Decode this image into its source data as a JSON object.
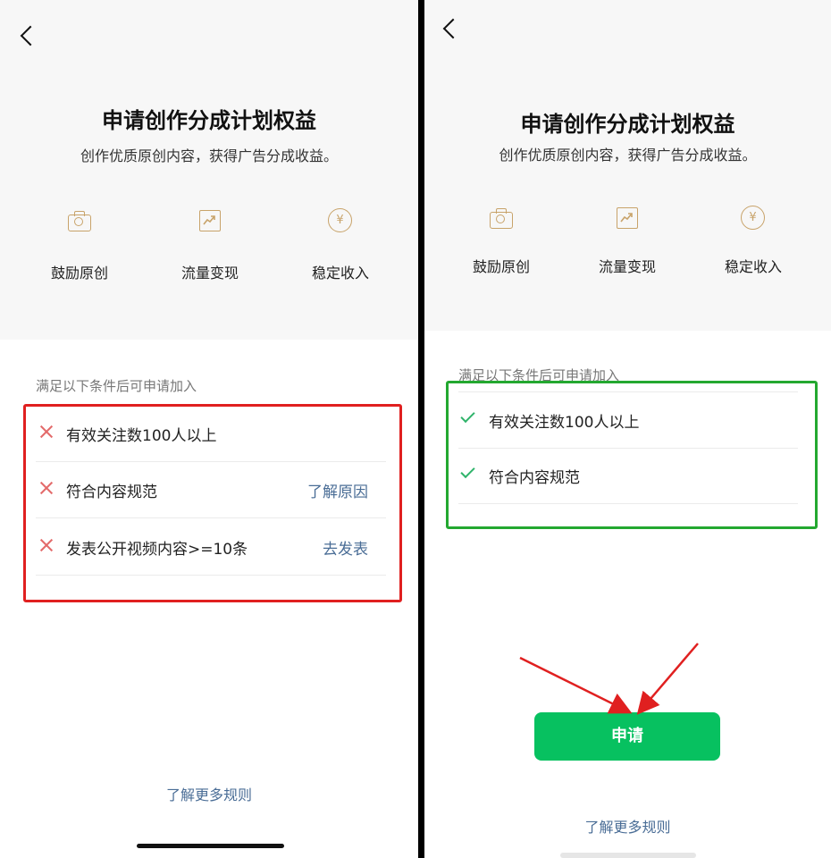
{
  "left": {
    "title": "申请创作分成计划权益",
    "subtitle": "创作优质原创内容，获得广告分成收益。",
    "features": [
      {
        "icon": "camera-icon",
        "label": "鼓励原创"
      },
      {
        "icon": "trend-chart-icon",
        "label": "流量变现"
      },
      {
        "icon": "yen-icon",
        "label": "稳定收入"
      }
    ],
    "conditions_label": "满足以下条件后可申请加入",
    "conditions": [
      {
        "text": "有效关注数100人以上",
        "action": ""
      },
      {
        "text": "符合内容规范",
        "action": "了解原因"
      },
      {
        "text": "发表公开视频内容>=10条",
        "action": "去发表"
      }
    ],
    "more_rules": "了解更多规则",
    "colors": {
      "highlight": "#e02020",
      "fail": "#e36a6a"
    }
  },
  "right": {
    "title": "申请创作分成计划权益",
    "subtitle": "创作优质原创内容，获得广告分成收益。",
    "features": [
      {
        "icon": "camera-icon",
        "label": "鼓励原创"
      },
      {
        "icon": "trend-chart-icon",
        "label": "流量变现"
      },
      {
        "icon": "yen-icon",
        "label": "稳定收入"
      }
    ],
    "conditions_label": "满足以下条件后可申请加入",
    "conditions": [
      {
        "text": "有效关注数100人以上"
      },
      {
        "text": "符合内容规范"
      }
    ],
    "apply_button": "申请",
    "more_rules": "了解更多规则",
    "colors": {
      "highlight": "#23a830",
      "pass": "#2fb36a",
      "button": "#07c160",
      "arrow": "#e02020"
    }
  }
}
